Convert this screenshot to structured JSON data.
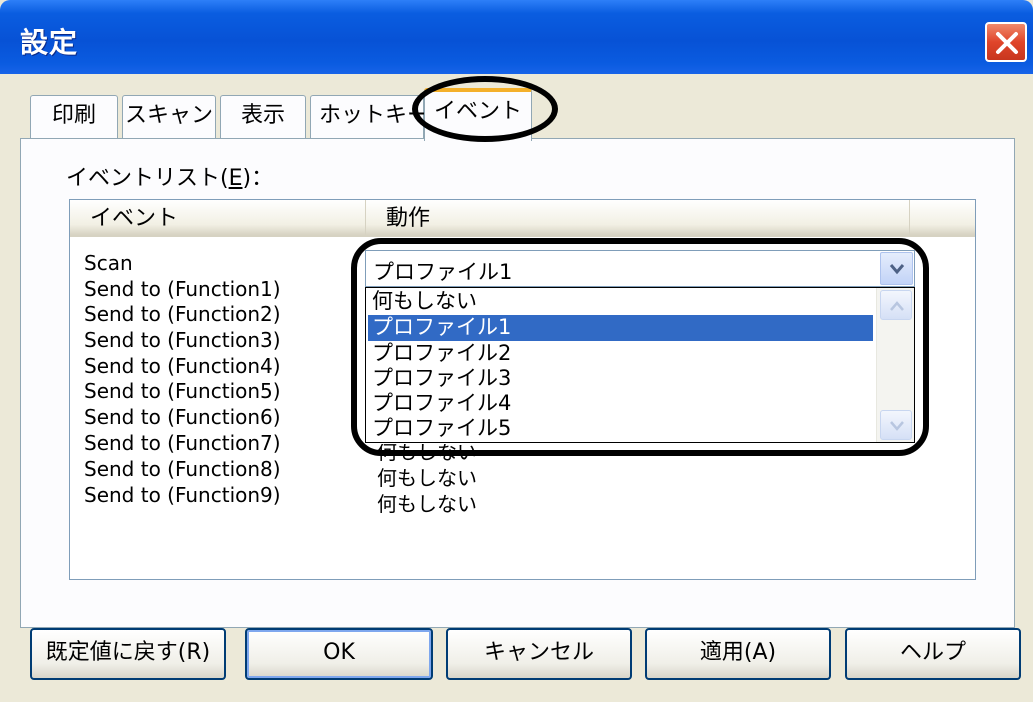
{
  "window": {
    "title": "設定"
  },
  "tabs": [
    {
      "label": "印刷"
    },
    {
      "label": "スキャン"
    },
    {
      "label": "表示"
    },
    {
      "label": "ホットキー"
    },
    {
      "label": "イベント"
    }
  ],
  "active_tab": "イベント",
  "event_list": {
    "label_prefix": "イベントリスト(",
    "label_key": "E",
    "label_suffix": ")：",
    "columns": [
      "イベント",
      "動作"
    ],
    "rows": [
      {
        "event": "Scan",
        "action": "プロファイル1"
      },
      {
        "event": "Send to (Function1)",
        "action": ""
      },
      {
        "event": "Send to (Function2)",
        "action": ""
      },
      {
        "event": "Send to (Function3)",
        "action": ""
      },
      {
        "event": "Send to (Function4)",
        "action": ""
      },
      {
        "event": "Send to (Function5)",
        "action": ""
      },
      {
        "event": "Send to (Function6)",
        "action": ""
      },
      {
        "event": "Send to (Function7)",
        "action": "何もしない"
      },
      {
        "event": "Send to (Function8)",
        "action": "何もしない"
      },
      {
        "event": "Send to (Function9)",
        "action": "何もしない"
      }
    ]
  },
  "combo": {
    "value": "プロファイル1",
    "options": [
      "何もしない",
      "プロファイル1",
      "プロファイル2",
      "プロファイル3",
      "プロファイル4",
      "プロファイル5"
    ],
    "selected": "プロファイル1"
  },
  "buttons": {
    "reset": "既定値に戻す(R)",
    "ok": "OK",
    "cancel": "キャンセル",
    "apply": "適用(A)",
    "help": "ヘルプ"
  },
  "colors": {
    "titlebar": "#0752d6",
    "selection": "#316ac5",
    "active_tab_accent": "#f4b02a",
    "close": "#e0452a"
  },
  "icons": {
    "close": "close-icon",
    "combo_arrow": "chevron-down-icon",
    "scroll_up": "chevron-up-icon",
    "scroll_down": "chevron-down-icon"
  }
}
